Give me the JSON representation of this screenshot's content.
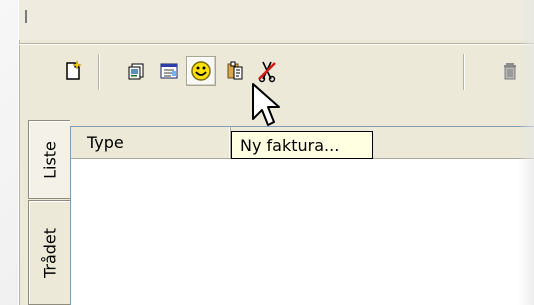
{
  "tooltip": {
    "text": "Ny faktura..."
  },
  "tabs": [
    {
      "label": "Liste",
      "active": true
    },
    {
      "label": "Trådet",
      "active": false
    }
  ],
  "list": {
    "columns": [
      {
        "label": "Type"
      },
      {
        "label": ""
      }
    ],
    "rows": []
  },
  "toolbar": {
    "buttons": [
      {
        "icon": "new-document-icon",
        "active": false
      },
      {
        "icon": "document-view-icon",
        "active": false
      },
      {
        "icon": "window-list-icon",
        "active": false
      },
      {
        "icon": "smiley-icon",
        "active": true
      },
      {
        "icon": "paste-document-icon",
        "active": false
      },
      {
        "icon": "no-scissors-icon",
        "active": false
      },
      {
        "icon": "trash-icon",
        "active": false
      }
    ]
  }
}
